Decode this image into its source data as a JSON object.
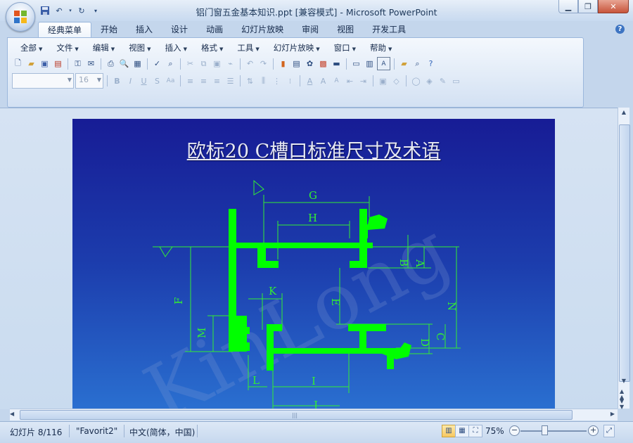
{
  "window": {
    "title": "铝门窗五金基本知识.ppt [兼容模式] - Microsoft PowerPoint",
    "controls": [
      "minimize",
      "restore",
      "close"
    ]
  },
  "quick_access": [
    "save-icon",
    "undo-icon",
    "redo-icon",
    "customize-icon"
  ],
  "ribbon": {
    "tabs": [
      {
        "label": "经典菜单",
        "active": true
      },
      {
        "label": "开始"
      },
      {
        "label": "插入"
      },
      {
        "label": "设计"
      },
      {
        "label": "动画"
      },
      {
        "label": "幻灯片放映"
      },
      {
        "label": "审阅"
      },
      {
        "label": "视图"
      },
      {
        "label": "开发工具"
      }
    ],
    "menus": [
      "全部",
      "文件",
      "编辑",
      "视图",
      "插入",
      "格式",
      "工具",
      "幻灯片放映",
      "窗口",
      "帮助"
    ],
    "font_size_value": "16"
  },
  "slide": {
    "title": "欧标20 C槽口标准尺寸及术语",
    "watermark": "KinLong",
    "dimension_labels": [
      "G",
      "H",
      "B",
      "A",
      "K",
      "F",
      "E",
      "N",
      "M",
      "C",
      "D",
      "L",
      "I",
      "J"
    ],
    "colors": {
      "profile": "#00ff00",
      "dimension_line": "#33ee33",
      "background_top": "#171c95",
      "background_bottom": "#2a6fd0"
    }
  },
  "status": {
    "slide_info": "幻灯片 8/116",
    "theme": "\"Favorit2\"",
    "language": "中文(简体，中国)",
    "zoom": "75%"
  }
}
